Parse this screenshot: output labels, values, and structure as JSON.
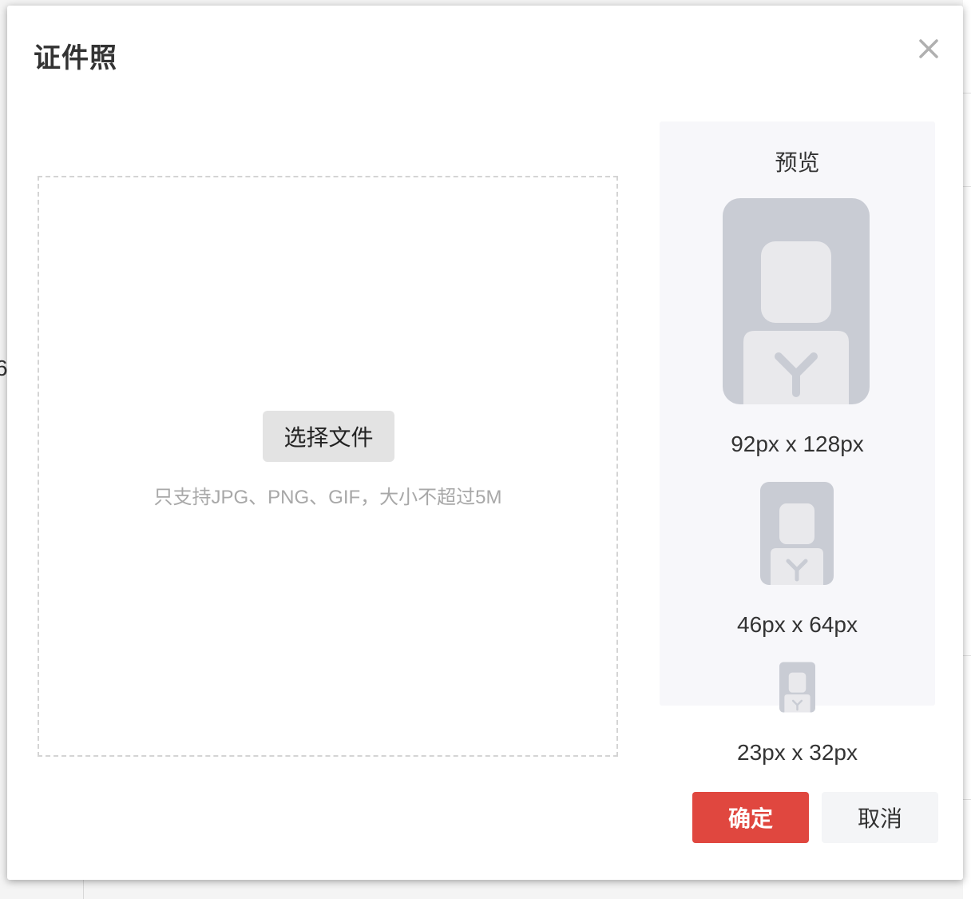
{
  "background": {
    "glyph": "6"
  },
  "dialog": {
    "title": "证件照",
    "close_icon": "close-icon"
  },
  "upload": {
    "button_label": "选择文件",
    "hint": "只支持JPG、PNG、GIF，大小不超过5M"
  },
  "preview": {
    "title": "预览",
    "sizes": [
      {
        "label": "92px x 128px"
      },
      {
        "label": "46px x 64px"
      },
      {
        "label": "23px x 32px"
      }
    ]
  },
  "footer": {
    "confirm_label": "确定",
    "cancel_label": "取消"
  },
  "colors": {
    "primary": "#e0473f",
    "avatar_bg": "#c9ccd4",
    "avatar_fg": "#e9e9ec",
    "preview_bg": "#f7f7fa"
  }
}
